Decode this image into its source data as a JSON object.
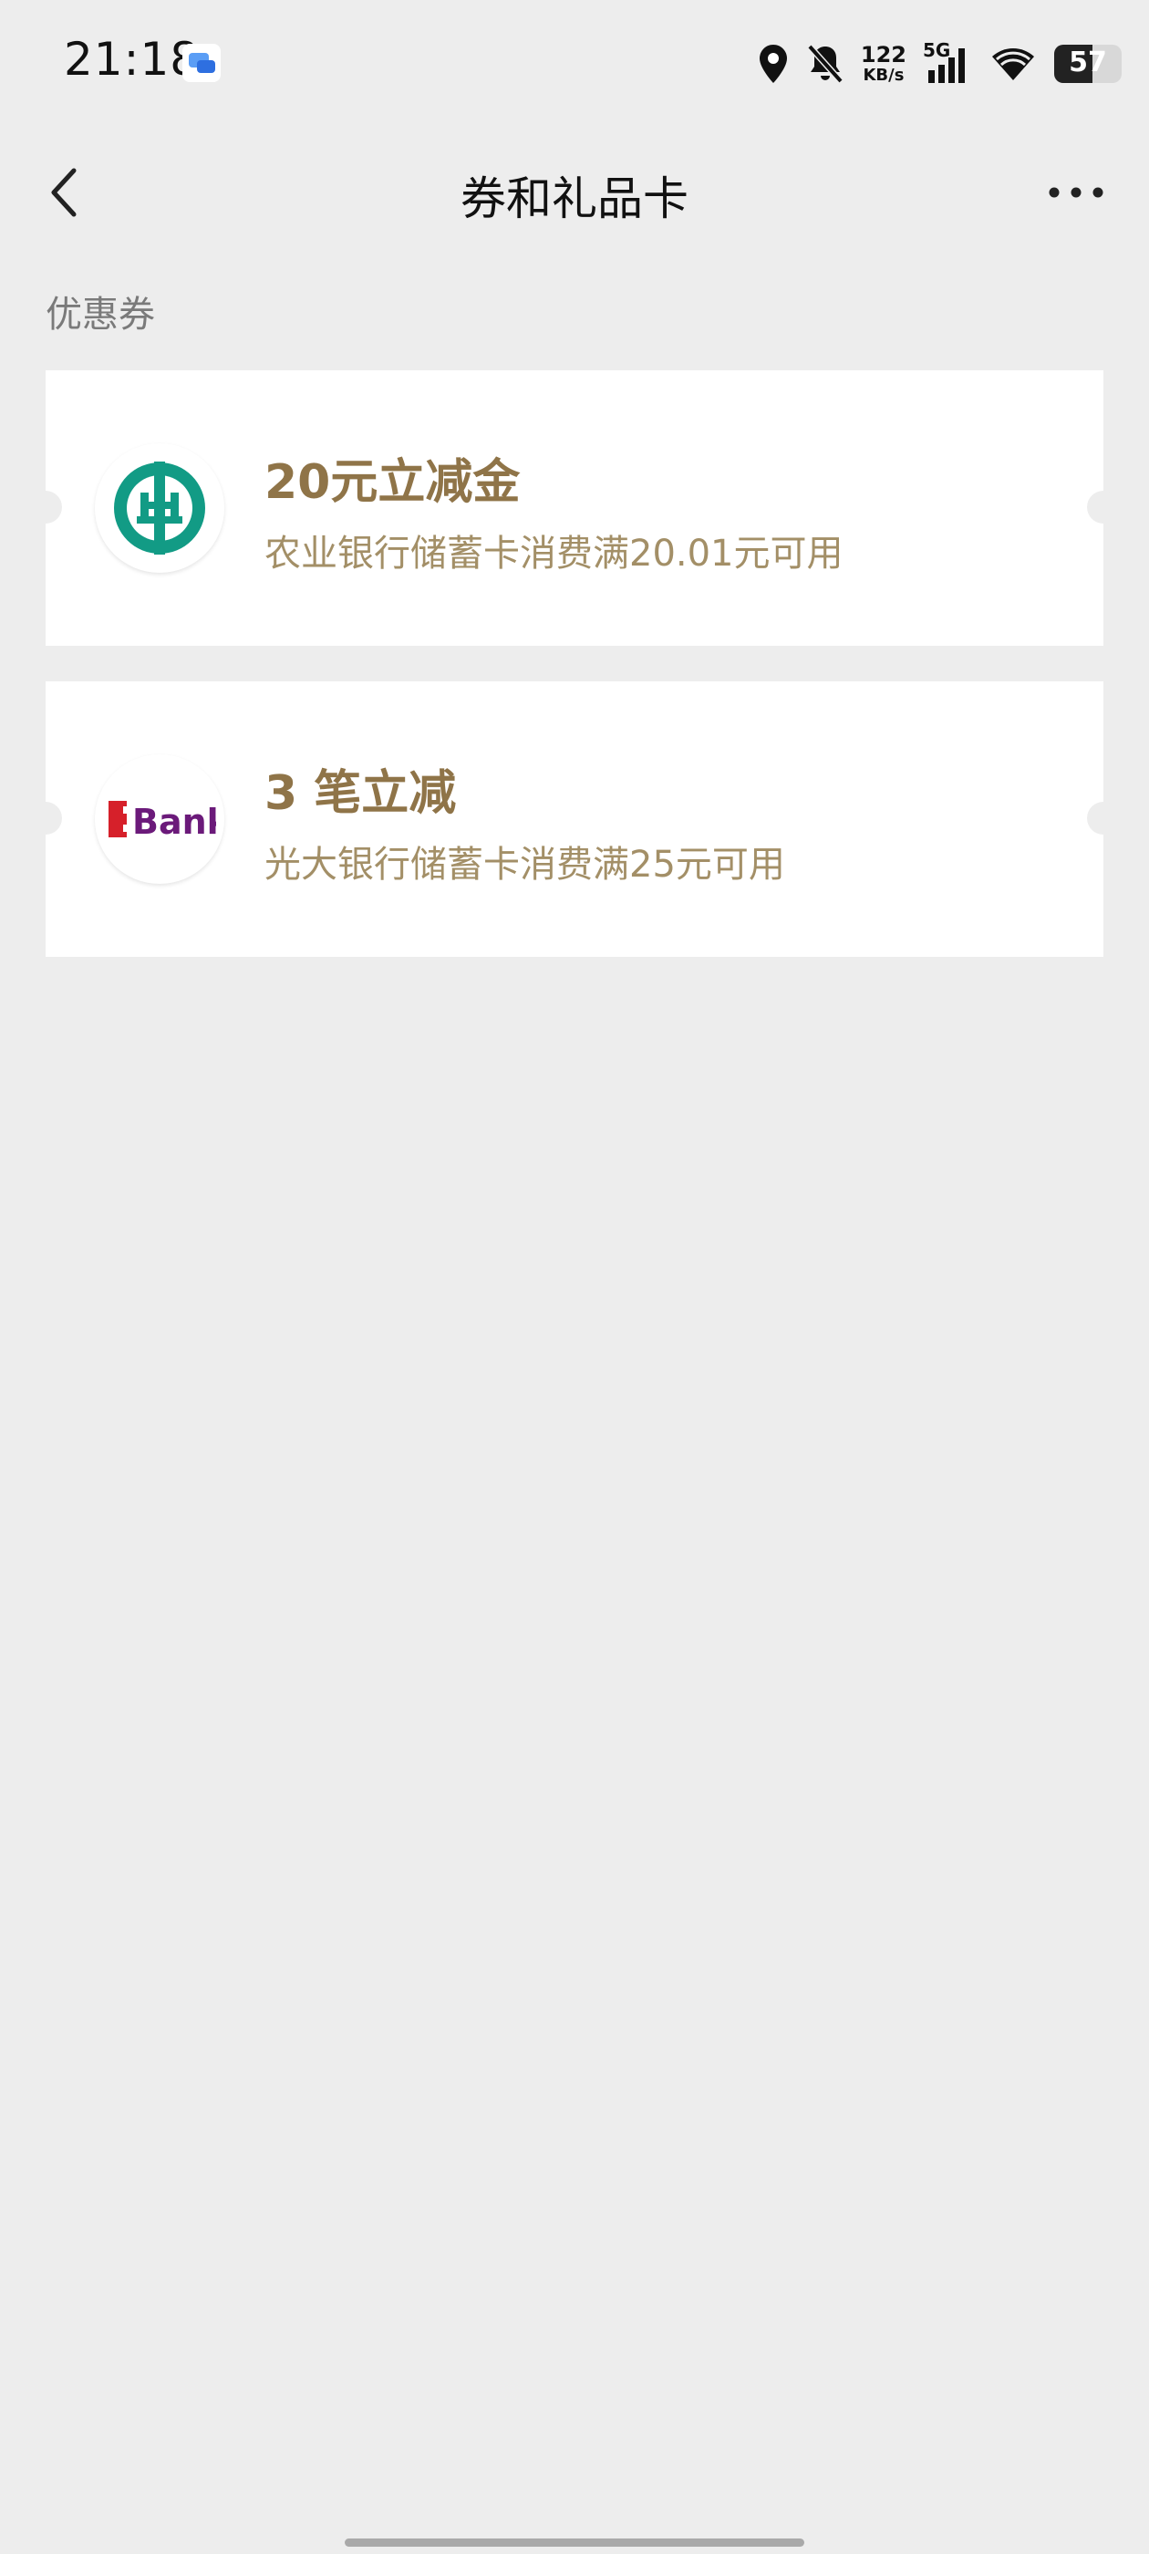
{
  "status_bar": {
    "time": "21:18",
    "network_speed_value": "122",
    "network_speed_unit": "KB/s",
    "network_type": "5G",
    "battery_level": "57",
    "icons": [
      "chat-notification-icon",
      "location-icon",
      "bell-off-icon",
      "signal-icon",
      "wifi-icon",
      "battery-icon"
    ]
  },
  "nav": {
    "title": "券和礼品卡",
    "back_icon": "chevron-left-icon",
    "more_icon": "more-horizontal-icon"
  },
  "section": {
    "label": "优惠券"
  },
  "coupons": [
    {
      "title": "20元立减金",
      "description": "农业银行储蓄卡消费满20.01元可用",
      "logo": "abc-bank-logo"
    },
    {
      "title": "3 笔立减",
      "description": "光大银行储蓄卡消费满25元可用",
      "logo": "ebank-logo",
      "logo_text": "Bank"
    }
  ],
  "colors": {
    "background": "#ededed",
    "card": "#ffffff",
    "coupon_title": "#8f7448",
    "coupon_desc": "#a38f67",
    "abc_green": "#129b85",
    "ebank_red": "#d6202a",
    "ebank_purple": "#6b1a7a"
  }
}
